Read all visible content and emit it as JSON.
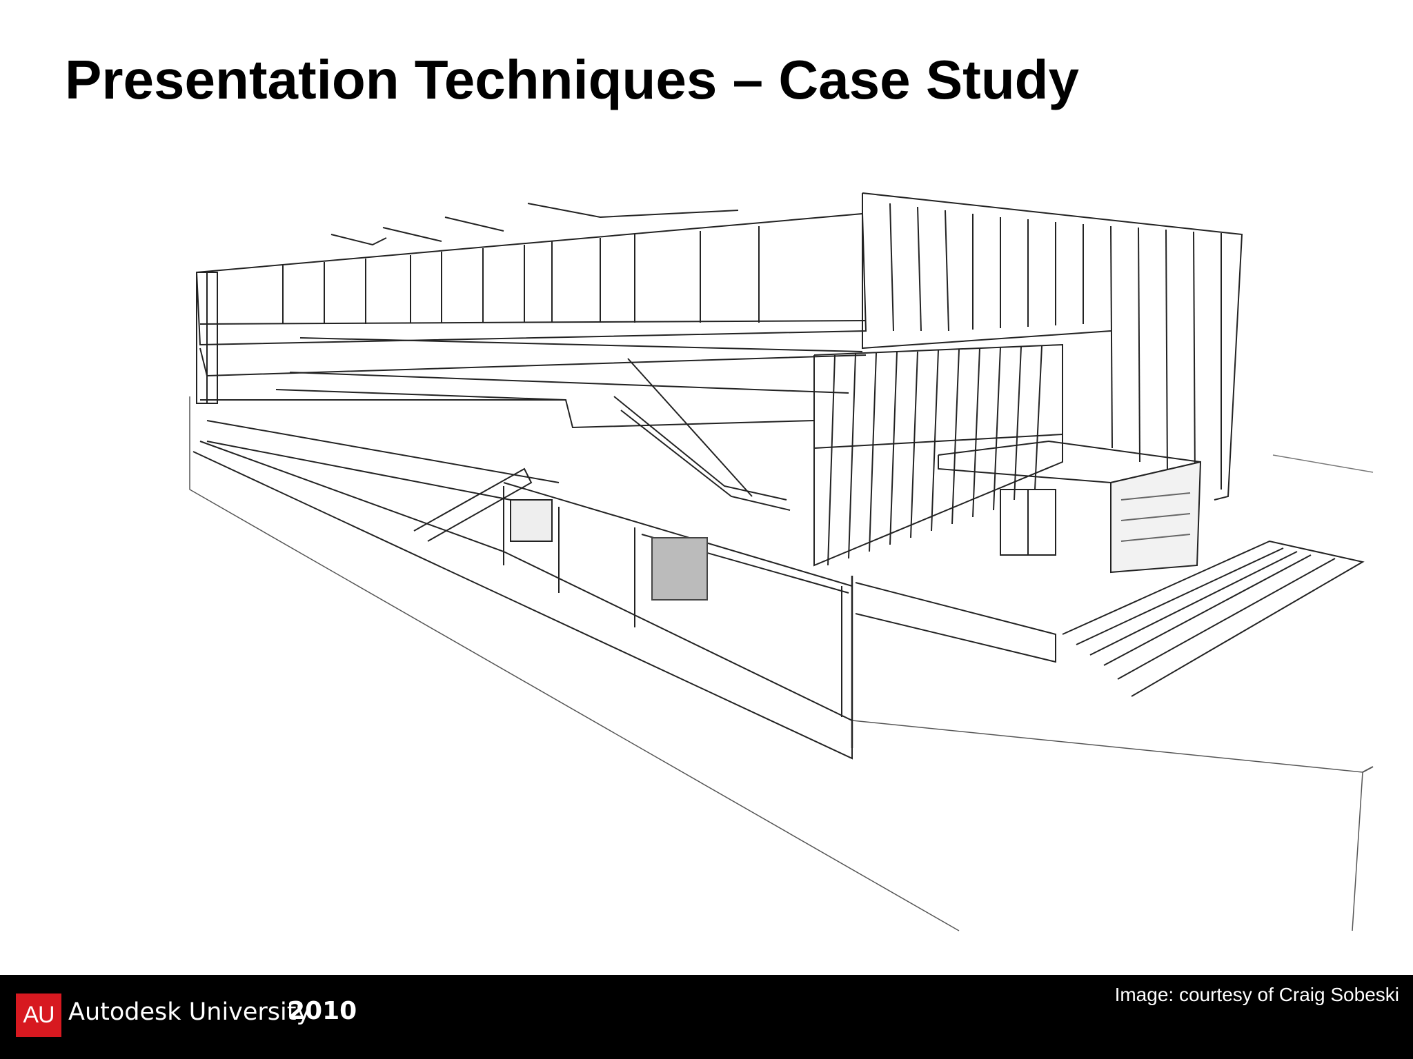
{
  "slide": {
    "title": "Presentation Techniques – Case Study"
  },
  "footer": {
    "logo_text": "AU",
    "brand_name": "Autodesk University",
    "brand_year": "2010",
    "credit": "Image: courtesy of Craig Sobeski",
    "logo_color": "#d71920",
    "bar_color": "#000000"
  }
}
